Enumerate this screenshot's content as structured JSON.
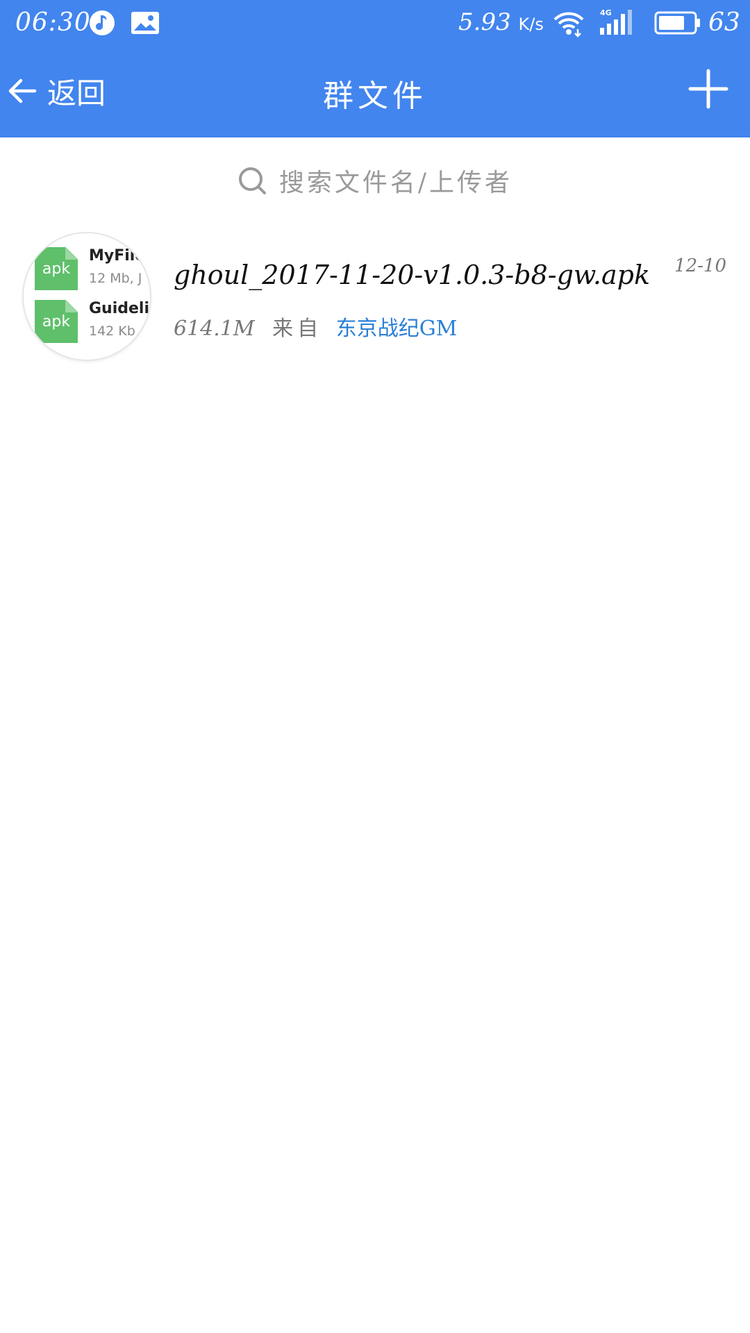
{
  "status_bar": {
    "time": "06:30",
    "network_speed": "5.93",
    "network_speed_unit": "K/s",
    "signal_type": "4G",
    "battery_level": "63",
    "icons": [
      "music-icon",
      "gallery-icon",
      "wifi-icon",
      "signal-icon",
      "battery-icon"
    ]
  },
  "header": {
    "back_label": "返回",
    "title": "群文件",
    "add_icon": "plus-icon"
  },
  "search": {
    "placeholder": "搜索文件名/上传者"
  },
  "files": [
    {
      "name": "ghoul_2017-11-20-v1.0.3-b8-gw.apk",
      "size": "614.1M",
      "from_label": "来自",
      "uploader": "东京战纪GM",
      "date": "12-10",
      "thumbnail": {
        "entries": [
          {
            "badge": "apk",
            "name": "MyFile",
            "meta": "12 Mb, J"
          },
          {
            "badge": "apk",
            "name": "Guideli",
            "meta": "142 Kb"
          }
        ]
      }
    }
  ],
  "colors": {
    "header_bg": "#4285ee",
    "uploader_link": "#2a7fd6",
    "apk_badge": "#5fbf6a"
  }
}
